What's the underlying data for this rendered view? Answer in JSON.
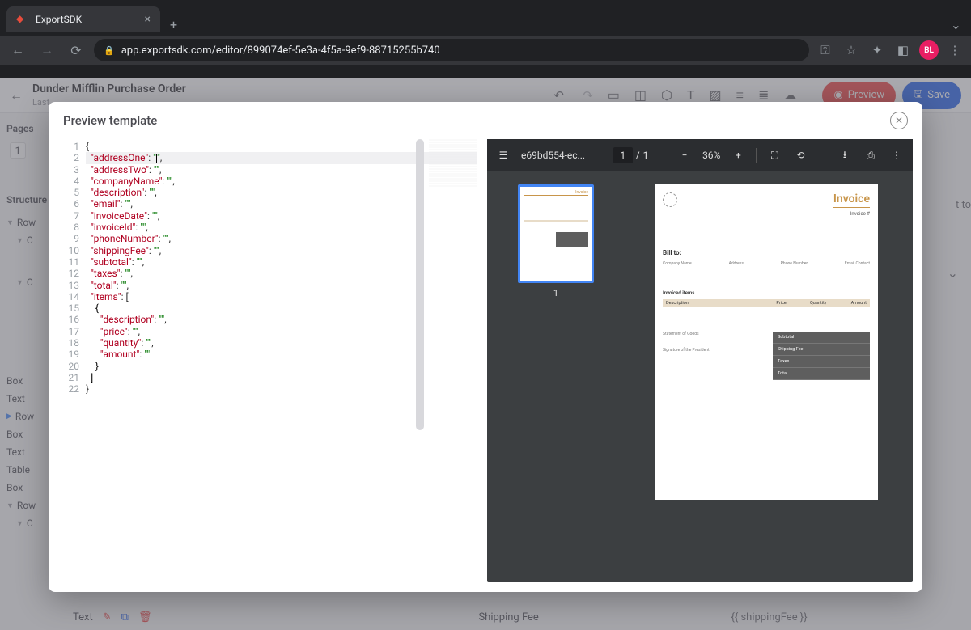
{
  "browser": {
    "tab_title": "ExportSDK",
    "url": "app.exportsdk.com/editor/899074ef-5e3a-4f5a-9ef9-88715255b740",
    "avatar_initials": "BL"
  },
  "editor": {
    "doc_title": "Dunder Mifflin Purchase Order",
    "doc_sub": "Last",
    "preview_label": "Preview",
    "save_label": "Save",
    "pages_label": "Pages",
    "page_number": "1",
    "structure_label": "Structure",
    "tree": [
      "Row",
      "C",
      "C",
      "Box",
      "Text",
      "Row",
      "Box",
      "Text",
      "Table",
      "Box",
      "Row",
      "C"
    ],
    "right_partial": "t to",
    "bottom_text_label": "Text",
    "bottom_ship_label": "Shipping Fee",
    "bottom_ship_expr": "{{ shippingFee }}"
  },
  "modal": {
    "title": "Preview template",
    "code_lines": [
      "{",
      "  \"addressOne\": \"\",",
      "  \"addressTwo\": \"\",",
      "  \"companyName\": \"\",",
      "  \"description\": \"\",",
      "  \"email\": \"\",",
      "  \"invoiceDate\": \"\",",
      "  \"invoiceId\": \"\",",
      "  \"phoneNumber\": \"\",",
      "  \"shippingFee\": \"\",",
      "  \"subtotal\": \"\",",
      "  \"taxes\": \"\",",
      "  \"total\": \"\",",
      "  \"items\": [",
      "    {",
      "      \"description\": \"\",",
      "      \"price\": \"\",",
      "      \"quantity\": \"\",",
      "      \"amount\": \"\"",
      "    }",
      "  ]",
      "}"
    ]
  },
  "pdf": {
    "filename": "e69bd554-ec...",
    "page_current": "1",
    "page_total": "1",
    "zoom": "36%",
    "thumb_num": "1",
    "invoice": {
      "title": "Invoice",
      "invoice_no_label": "Invoice #",
      "billto": "Bill to:",
      "col_company": "Company Name",
      "col_address": "Address",
      "col_phone": "Phone Number",
      "col_email": "Email Contact",
      "items_label": "Invoiced items",
      "th_desc": "Description",
      "th_price": "Price",
      "th_qty": "Quantity",
      "th_amount": "Amount",
      "stmt": "Statement of Goods",
      "sig": "Signature of the President",
      "tot_subtotal": "Subtotal",
      "tot_shipping": "Shipping Fee",
      "tot_taxes": "Taxes",
      "tot_total": "Total"
    }
  }
}
